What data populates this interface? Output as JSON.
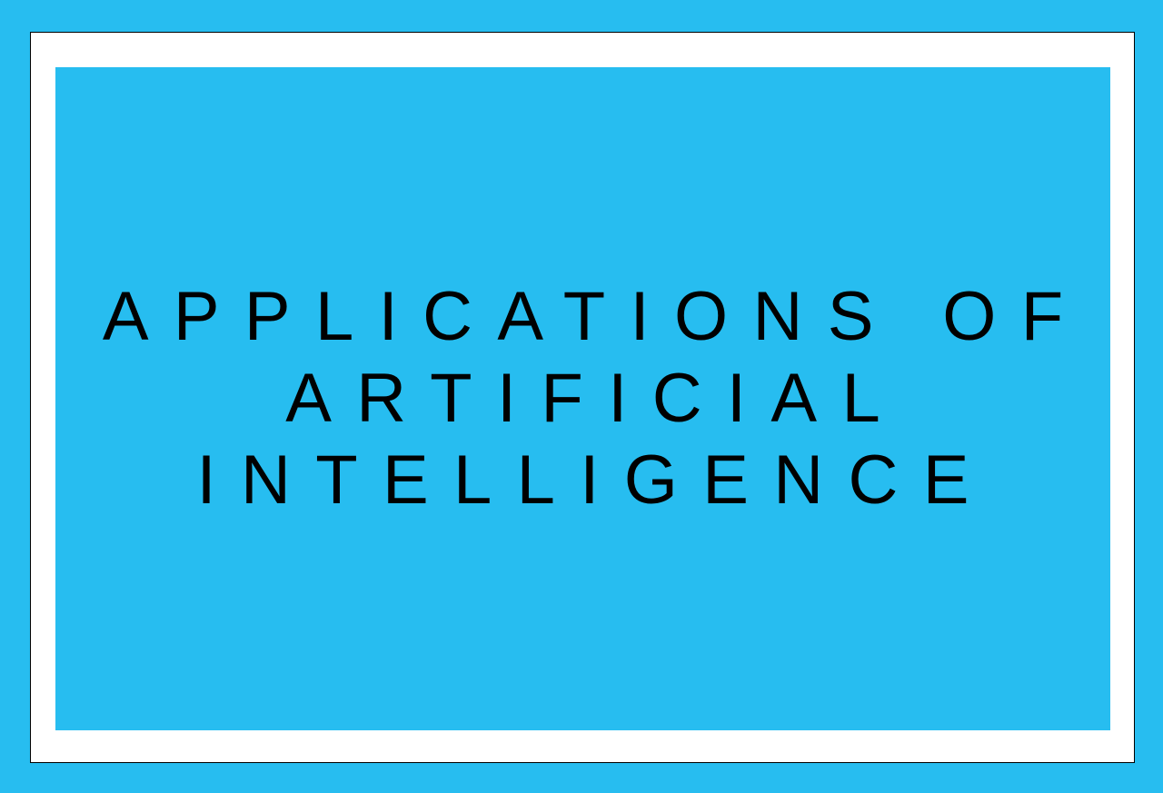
{
  "colors": {
    "background": "#27bdf0",
    "frame": "#ffffff",
    "frame_border": "#000000",
    "panel": "#27bdf0",
    "text": "#000000"
  },
  "title": {
    "lines": [
      "APPLICATIONS OF",
      "ARTIFICIAL",
      "INTELLIGENCE"
    ]
  }
}
